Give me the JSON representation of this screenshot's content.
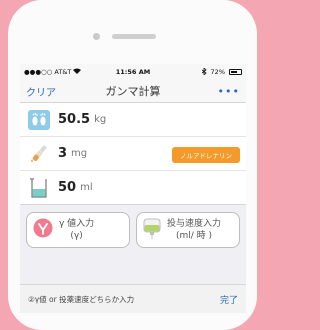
{
  "status_bar": {
    "carrier": "●●●○○ AT&T",
    "time": "11:56 AM",
    "battery": "72%",
    "battery_level": 0.72
  },
  "nav": {
    "left_label": "クリア",
    "title": "ガンマ計算",
    "more_label": "•••"
  },
  "inputs": {
    "weight": {
      "value": "50.5",
      "unit": "kg"
    },
    "dose": {
      "value": "3",
      "unit": "mg",
      "drug": "ノルアドレナリン"
    },
    "volume": {
      "value": "50",
      "unit": "ml"
    }
  },
  "buttons": {
    "gamma": {
      "line1": "γ 値入力",
      "line2": "(γ)"
    },
    "rate": {
      "line1": "投与速度入力",
      "line2": "(ml/ 時 )"
    }
  },
  "bottom": {
    "hint": "②γ値 or 投薬速度どちらか入力",
    "done": "完了"
  },
  "colors": {
    "background": "#f4a6b2",
    "accent": "#2a6ab5",
    "badge": "#f39a2b",
    "gamma_icon": "#f07a8e"
  }
}
